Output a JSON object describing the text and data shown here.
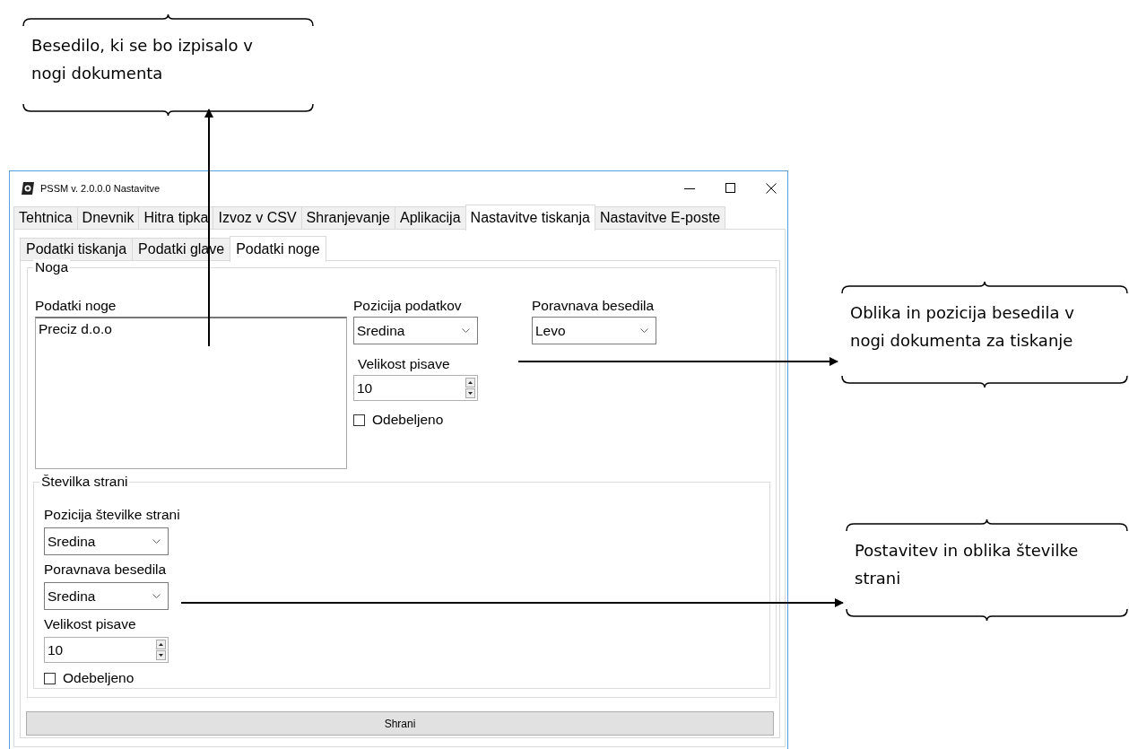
{
  "window": {
    "title": "PSSM v. 2.0.0.0 Nastavitve"
  },
  "tabs": [
    {
      "label": "Tehtnica",
      "selected": false
    },
    {
      "label": "Dnevnik",
      "selected": false
    },
    {
      "label": "Hitra tipka",
      "selected": false
    },
    {
      "label": "Izvoz v CSV",
      "selected": false
    },
    {
      "label": "Shranjevanje",
      "selected": false
    },
    {
      "label": "Aplikacija",
      "selected": false
    },
    {
      "label": "Nastavitve tiskanja",
      "selected": true
    },
    {
      "label": "Nastavitve E-poste",
      "selected": false
    }
  ],
  "subtabs": [
    {
      "label": "Podatki tiskanja",
      "selected": false
    },
    {
      "label": "Podatki glave",
      "selected": false
    },
    {
      "label": "Podatki noge",
      "selected": true
    }
  ],
  "footer_group": {
    "title": "Noga",
    "data_label": "Podatki noge",
    "data_value": "Preciz d.o.o",
    "position_label": "Pozicija podatkov",
    "position_value": "Sredina",
    "size_label": "Velikost pisave",
    "size_value": "10",
    "bold_label": "Odebeljeno",
    "bold_checked": false,
    "align_label": "Poravnava besedila",
    "align_value": "Levo"
  },
  "page_number_group": {
    "title": "Številka strani",
    "position_label": "Pozicija številke strani",
    "position_value": "Sredina",
    "align_label": "Poravnava besedila",
    "align_value": "Sredina",
    "size_label": "Velikost pisave",
    "size_value": "10",
    "bold_label": "Odebeljeno",
    "bold_checked": false
  },
  "save_button": "Shrani",
  "callouts": [
    {
      "text": "Besedilo, ki se bo izpisalo v nogi dokumenta"
    },
    {
      "text": "Oblika in pozicija besedila v nogi dokumenta za tiskanje"
    },
    {
      "text": "Postavitev in oblika številke strani"
    }
  ]
}
